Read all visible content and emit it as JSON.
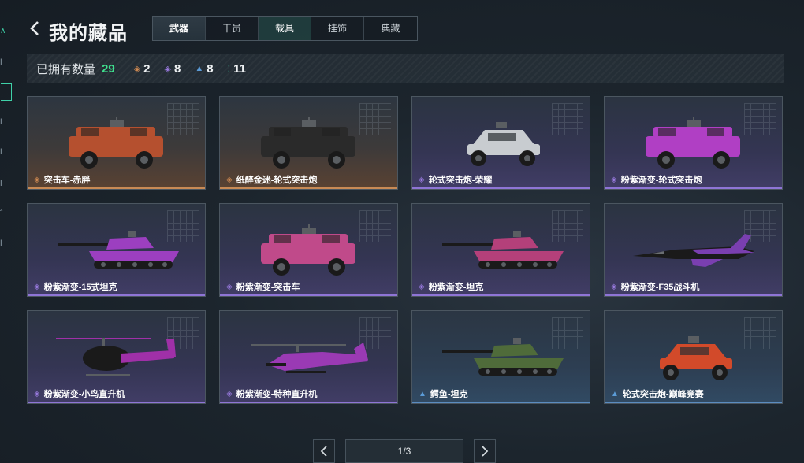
{
  "header": {
    "title": "我的藏品"
  },
  "tabs": [
    {
      "label": "武器",
      "state": "selected"
    },
    {
      "label": "干员",
      "state": "normal"
    },
    {
      "label": "载具",
      "state": "current"
    },
    {
      "label": "挂饰",
      "state": "normal"
    },
    {
      "label": "典藏",
      "state": "normal"
    }
  ],
  "summary": {
    "label": "已拥有数量",
    "total": "29",
    "rarities": [
      {
        "icon": "gold-diamond-icon",
        "color": "#d08a52",
        "count": "2"
      },
      {
        "icon": "purple-diamond-icon",
        "color": "#9a7be0",
        "count": "8"
      },
      {
        "icon": "blue-diamond-icon",
        "color": "#5b9bd6",
        "count": "8"
      },
      {
        "icon": "green-dots-icon",
        "color": "#3fd1a8",
        "count": "11"
      }
    ]
  },
  "items": [
    {
      "name": "突击车-赤胖",
      "rarity": "gold",
      "kind": "armored-car",
      "paint": "#b5502f"
    },
    {
      "name": "纸醉金迷-轮式突击炮",
      "rarity": "gold",
      "kind": "armored-car",
      "paint": "#2a2a2a"
    },
    {
      "name": "轮式突击炮-荣耀",
      "rarity": "purple",
      "kind": "buggy",
      "paint": "#c8ccd0"
    },
    {
      "name": "粉紫渐变-轮式突击炮",
      "rarity": "purple",
      "kind": "armored-car",
      "paint": "#b03fc4"
    },
    {
      "name": "粉紫渐变-15式坦克",
      "rarity": "purple",
      "kind": "tank",
      "paint": "#9c3fc0"
    },
    {
      "name": "粉紫渐变-突击车",
      "rarity": "purple",
      "kind": "armored-car",
      "paint": "#c04a8a"
    },
    {
      "name": "粉紫渐变-坦克",
      "rarity": "purple",
      "kind": "tank",
      "paint": "#b4407a"
    },
    {
      "name": "粉紫渐变-F35战斗机",
      "rarity": "purple",
      "kind": "jet",
      "paint": "#7a3fb0"
    },
    {
      "name": "粉紫渐变-小鸟直升机",
      "rarity": "purple",
      "kind": "heli-small",
      "paint": "#a030a8"
    },
    {
      "name": "粉紫渐变-特种直升机",
      "rarity": "purple",
      "kind": "heli-attack",
      "paint": "#9a3ab4"
    },
    {
      "name": "鳄鱼-坦克",
      "rarity": "blue",
      "kind": "tank",
      "paint": "#4f6b3a"
    },
    {
      "name": "轮式突击炮-巅峰竞赛",
      "rarity": "blue",
      "kind": "buggy",
      "paint": "#d24a2a"
    }
  ],
  "pager": {
    "label": "1/3"
  },
  "rarity_colors": {
    "gold": "#d08a52",
    "purple": "#9a7be0",
    "blue": "#5b9bd6"
  }
}
